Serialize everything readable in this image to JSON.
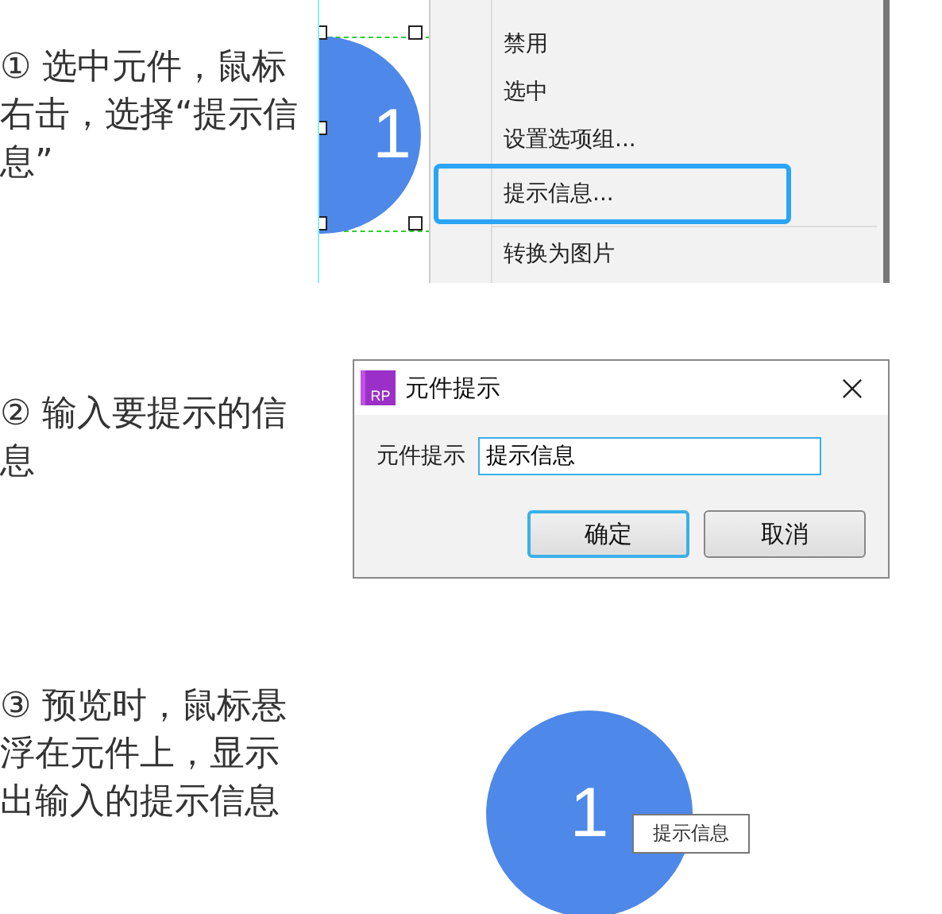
{
  "steps": [
    {
      "text": "① 选中元件，鼠标右击，选择“提示信息”",
      "kind": "context_menu",
      "widget_label": "1",
      "menu_items": [
        {
          "label": "禁用",
          "selected": false
        },
        {
          "label": "选中",
          "selected": false
        },
        {
          "label": "设置选项组...",
          "selected": false
        },
        {
          "label": "提示信息...",
          "selected": true
        },
        {
          "label": "转换为图片",
          "selected": false,
          "separator_before": true
        }
      ]
    },
    {
      "text": "② 输入要提示的信息",
      "kind": "dialog",
      "dialog": {
        "app_icon": "RP",
        "title": "元件提示",
        "field_label": "元件提示",
        "field_value": "提示信息",
        "buttons": [
          {
            "label": "确定",
            "selected": true
          },
          {
            "label": "取消",
            "selected": false
          }
        ]
      }
    },
    {
      "text": "③ 预览时，鼠标悬浮在元件上，显示出输入的提示信息",
      "kind": "preview",
      "widget_label": "1",
      "tooltip": "提示信息"
    }
  ]
}
